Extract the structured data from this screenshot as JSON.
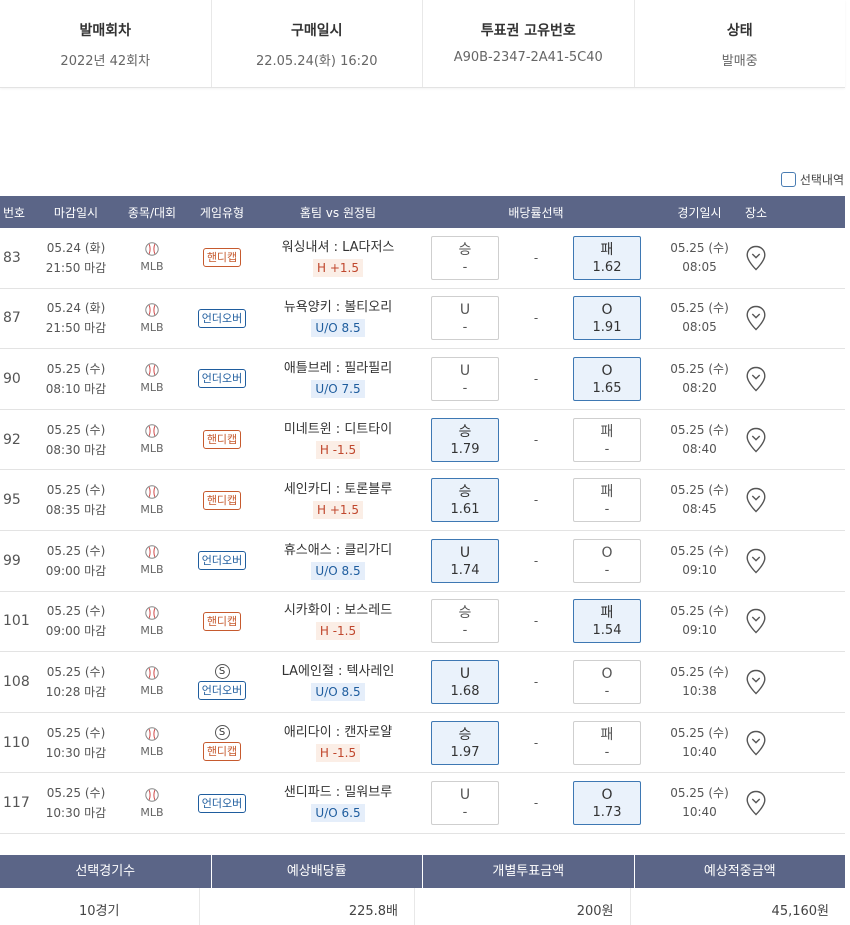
{
  "info": {
    "round_label": "발매회차",
    "round_value": "2022년 42회차",
    "purchase_label": "구매일시",
    "purchase_value": "22.05.24(화) 16:20",
    "id_label": "투표권 고유번호",
    "id_value": "A90B-2347-2A41-5C40",
    "status_label": "상태",
    "status_value": "발매중"
  },
  "select_history_label": "선택내역",
  "headers": {
    "no": "번호",
    "deadline": "마감일시",
    "sport": "종목/대회",
    "game_type": "게임유형",
    "teams": "홈팀 vs 원정팀",
    "odds_select": "배당률선택",
    "game_date": "경기일시",
    "place": "장소"
  },
  "colors": {
    "header_bg": "#5b6587",
    "handicap": "#c65a2e",
    "underover": "#1f5d9e",
    "selected_bg": "#eaf2fb",
    "selected_border": "#3e78b3"
  },
  "rows": [
    {
      "no": "83",
      "dd": "05.24 (화)",
      "dt": "21:50 마감",
      "sport": "MLB",
      "s": "",
      "type": "핸디캡",
      "tcls": "h",
      "teams": "워싱내셔 : LA다저스",
      "hc": "H +1.5",
      "b1": "승",
      "b1v": "-",
      "b1s": false,
      "dash": "-",
      "b2": "패",
      "b2v": "1.62",
      "b2s": true,
      "gd": "05.25 (수)",
      "gt": "08:05"
    },
    {
      "no": "87",
      "dd": "05.24 (화)",
      "dt": "21:50 마감",
      "sport": "MLB",
      "s": "",
      "type": "언더오버",
      "tcls": "uo",
      "teams": "뉴욕양키 : 볼티오리",
      "hc": "U/O 8.5",
      "b1": "U",
      "b1v": "-",
      "b1s": false,
      "dash": "-",
      "b2": "O",
      "b2v": "1.91",
      "b2s": true,
      "gd": "05.25 (수)",
      "gt": "08:05"
    },
    {
      "no": "90",
      "dd": "05.25 (수)",
      "dt": "08:10 마감",
      "sport": "MLB",
      "s": "",
      "type": "언더오버",
      "tcls": "uo",
      "teams": "애틀브레 : 필라필리",
      "hc": "U/O 7.5",
      "b1": "U",
      "b1v": "-",
      "b1s": false,
      "dash": "-",
      "b2": "O",
      "b2v": "1.65",
      "b2s": true,
      "gd": "05.25 (수)",
      "gt": "08:20"
    },
    {
      "no": "92",
      "dd": "05.25 (수)",
      "dt": "08:30 마감",
      "sport": "MLB",
      "s": "",
      "type": "핸디캡",
      "tcls": "h",
      "teams": "미네트윈 : 디트타이",
      "hc": "H -1.5",
      "b1": "승",
      "b1v": "1.79",
      "b1s": true,
      "dash": "-",
      "b2": "패",
      "b2v": "-",
      "b2s": false,
      "gd": "05.25 (수)",
      "gt": "08:40"
    },
    {
      "no": "95",
      "dd": "05.25 (수)",
      "dt": "08:35 마감",
      "sport": "MLB",
      "s": "",
      "type": "핸디캡",
      "tcls": "h",
      "teams": "세인카디 : 토론블루",
      "hc": "H +1.5",
      "b1": "승",
      "b1v": "1.61",
      "b1s": true,
      "dash": "-",
      "b2": "패",
      "b2v": "-",
      "b2s": false,
      "gd": "05.25 (수)",
      "gt": "08:45"
    },
    {
      "no": "99",
      "dd": "05.25 (수)",
      "dt": "09:00 마감",
      "sport": "MLB",
      "s": "",
      "type": "언더오버",
      "tcls": "uo",
      "teams": "휴스애스 : 클리가디",
      "hc": "U/O 8.5",
      "b1": "U",
      "b1v": "1.74",
      "b1s": true,
      "dash": "-",
      "b2": "O",
      "b2v": "-",
      "b2s": false,
      "gd": "05.25 (수)",
      "gt": "09:10"
    },
    {
      "no": "101",
      "dd": "05.25 (수)",
      "dt": "09:00 마감",
      "sport": "MLB",
      "s": "",
      "type": "핸디캡",
      "tcls": "h",
      "teams": "시카화이 : 보스레드",
      "hc": "H -1.5",
      "b1": "승",
      "b1v": "-",
      "b1s": false,
      "dash": "-",
      "b2": "패",
      "b2v": "1.54",
      "b2s": true,
      "gd": "05.25 (수)",
      "gt": "09:10"
    },
    {
      "no": "108",
      "dd": "05.25 (수)",
      "dt": "10:28 마감",
      "sport": "MLB",
      "s": "S",
      "type": "언더오버",
      "tcls": "uo",
      "teams": "LA에인절 : 텍사레인",
      "hc": "U/O 8.5",
      "b1": "U",
      "b1v": "1.68",
      "b1s": true,
      "dash": "-",
      "b2": "O",
      "b2v": "-",
      "b2s": false,
      "gd": "05.25 (수)",
      "gt": "10:38"
    },
    {
      "no": "110",
      "dd": "05.25 (수)",
      "dt": "10:30 마감",
      "sport": "MLB",
      "s": "S",
      "type": "핸디캡",
      "tcls": "h",
      "teams": "애리다이 : 캔자로얄",
      "hc": "H -1.5",
      "b1": "승",
      "b1v": "1.97",
      "b1s": true,
      "dash": "-",
      "b2": "패",
      "b2v": "-",
      "b2s": false,
      "gd": "05.25 (수)",
      "gt": "10:40"
    },
    {
      "no": "117",
      "dd": "05.25 (수)",
      "dt": "10:30 마감",
      "sport": "MLB",
      "s": "",
      "type": "언더오버",
      "tcls": "uo",
      "teams": "샌디파드 : 밀워브루",
      "hc": "U/O 6.5",
      "b1": "U",
      "b1v": "-",
      "b1s": false,
      "dash": "-",
      "b2": "O",
      "b2v": "1.73",
      "b2s": true,
      "gd": "05.25 (수)",
      "gt": "10:40"
    }
  ],
  "summary": {
    "h1": "선택경기수",
    "h2": "예상배당률",
    "h3": "개별투표금액",
    "h4": "예상적중금액",
    "v1": "10경기",
    "v2": "225.8배",
    "v3": "200원",
    "v4": "45,160원"
  }
}
